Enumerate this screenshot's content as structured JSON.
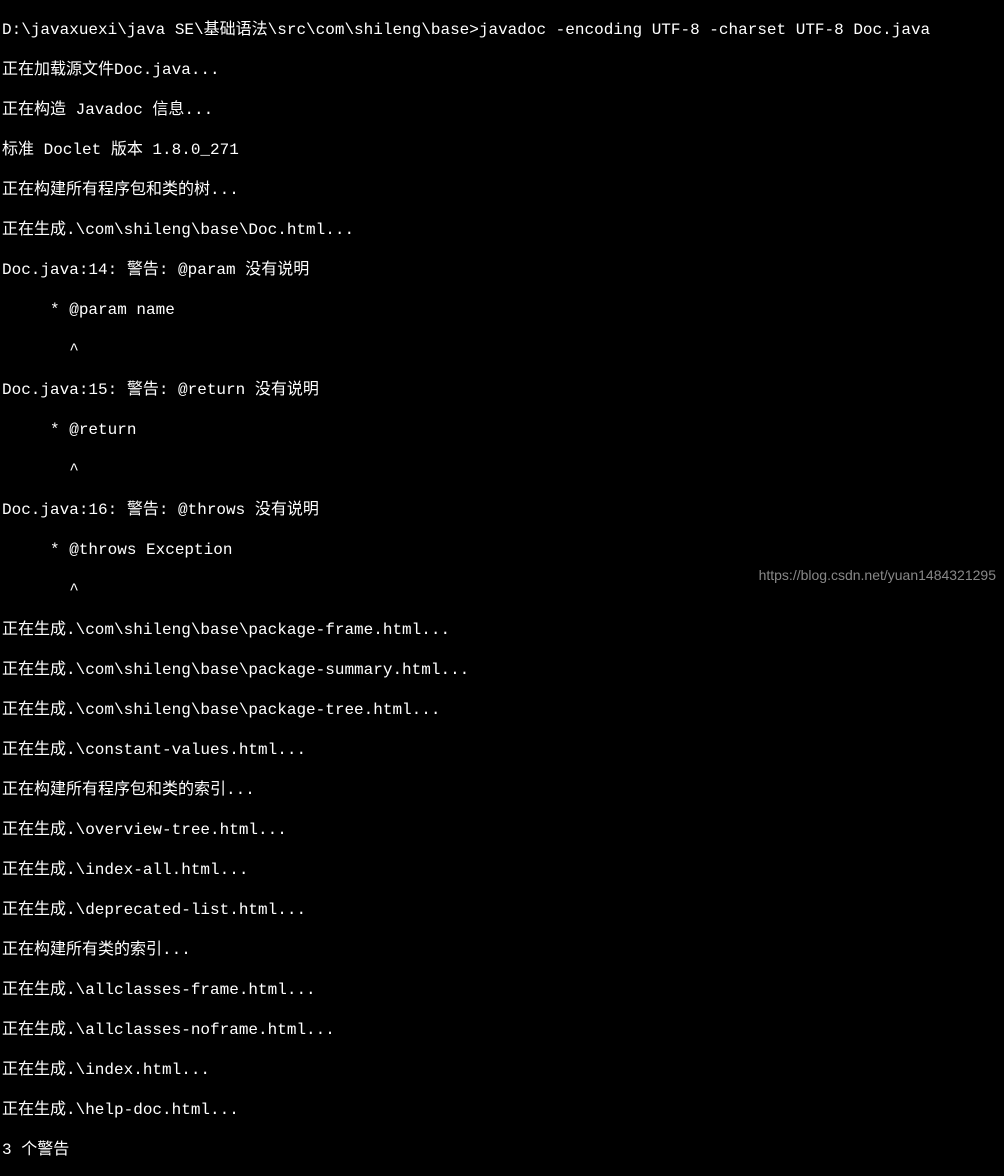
{
  "terminal": {
    "lines": [
      "D:\\javaxuexi\\java SE\\基础语法\\src\\com\\shileng\\base>javadoc -encoding UTF-8 -charset UTF-8 Doc.java",
      "正在加载源文件Doc.java...",
      "正在构造 Javadoc 信息...",
      "标准 Doclet 版本 1.8.0_271",
      "正在构建所有程序包和类的树...",
      "正在生成.\\com\\shileng\\base\\Doc.html...",
      "Doc.java:14: 警告: @param 没有说明",
      "     * @param name",
      "       ^",
      "Doc.java:15: 警告: @return 没有说明",
      "     * @return",
      "       ^",
      "Doc.java:16: 警告: @throws 没有说明",
      "     * @throws Exception",
      "       ^",
      "正在生成.\\com\\shileng\\base\\package-frame.html...",
      "正在生成.\\com\\shileng\\base\\package-summary.html...",
      "正在生成.\\com\\shileng\\base\\package-tree.html...",
      "正在生成.\\constant-values.html...",
      "正在构建所有程序包和类的索引...",
      "正在生成.\\overview-tree.html...",
      "正在生成.\\index-all.html...",
      "正在生成.\\deprecated-list.html...",
      "正在构建所有类的索引...",
      "正在生成.\\allclasses-frame.html...",
      "正在生成.\\allclasses-noframe.html...",
      "正在生成.\\index.html...",
      "正在生成.\\help-doc.html...",
      "3 个警告"
    ]
  },
  "watermark": "https://blog.csdn.net/yuan1484321295"
}
